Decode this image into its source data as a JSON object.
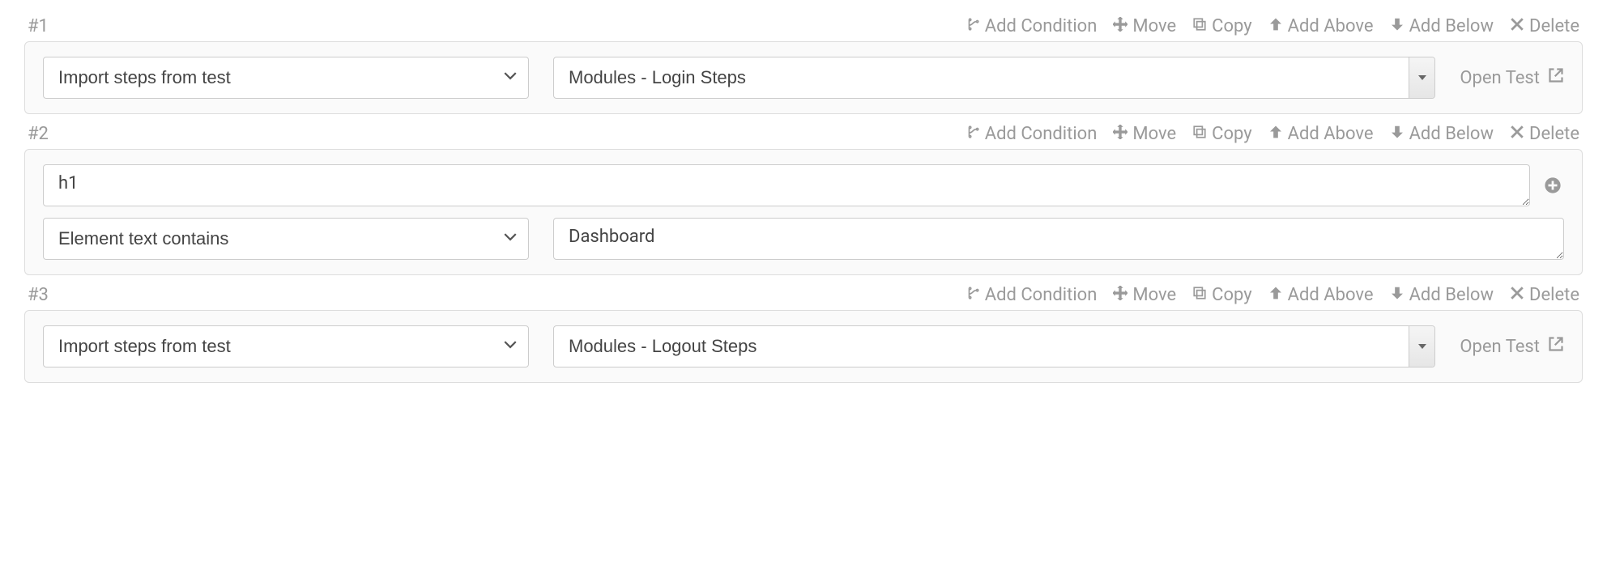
{
  "actions": {
    "add_condition": "Add Condition",
    "move": "Move",
    "copy": "Copy",
    "add_above": "Add Above",
    "add_below": "Add Below",
    "delete": "Delete"
  },
  "open_test_label": "Open Test",
  "steps": [
    {
      "num": "#1",
      "action_select": "Import steps from test",
      "combo_value": "Modules - Login Steps"
    },
    {
      "num": "#2",
      "selector_value": "h1",
      "action_select": "Element text contains",
      "value_text": "Dashboard"
    },
    {
      "num": "#3",
      "action_select": "Import steps from test",
      "combo_value": "Modules - Logout Steps"
    }
  ]
}
